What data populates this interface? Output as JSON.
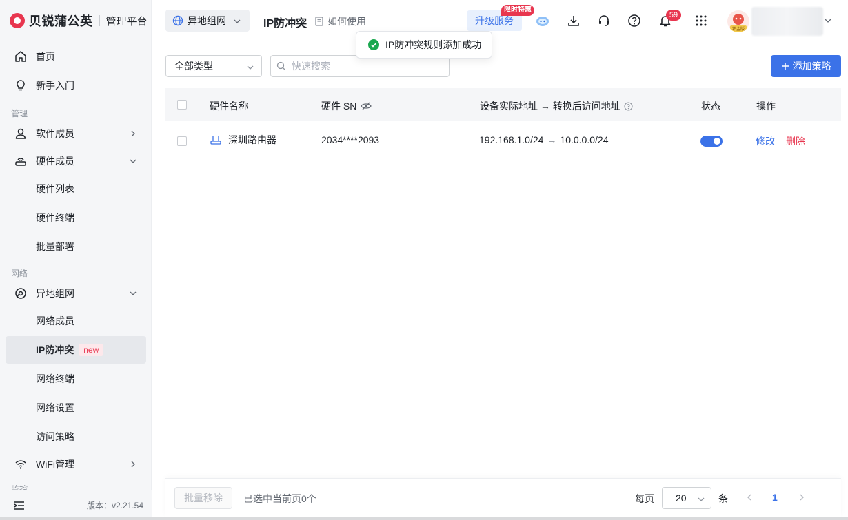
{
  "app": {
    "brand": "贝锐蒲公英",
    "platform": "管理平台",
    "version": "版本：v2.21.54"
  },
  "sidebar": {
    "items": [
      {
        "label": "首页"
      },
      {
        "label": "新手入门"
      },
      {
        "group": "管理"
      },
      {
        "label": "软件成员"
      },
      {
        "label": "硬件成员"
      },
      {
        "label": "硬件列表"
      },
      {
        "label": "硬件终端"
      },
      {
        "label": "批量部署"
      },
      {
        "group": "网络"
      },
      {
        "label": "异地组网"
      },
      {
        "label": "网络成员"
      },
      {
        "label": "IP防冲突",
        "badge": "new",
        "active": true
      },
      {
        "label": "网络终端"
      },
      {
        "label": "网络设置"
      },
      {
        "label": "访问策略"
      },
      {
        "label": "WiFi管理"
      },
      {
        "group": "监控"
      }
    ]
  },
  "topbar": {
    "network_selector": "异地组网",
    "page_title": "IP防冲突",
    "how_to": "如何使用",
    "upgrade_label": "升级服务",
    "promo_badge": "限时特惠",
    "notification_count": "59",
    "avatar_badge": "铂金版"
  },
  "toast": {
    "message": "IP防冲突规则添加成功",
    "type": "success"
  },
  "filters": {
    "type_select": "全部类型",
    "search_placeholder": "快速搜索",
    "add_button": "添加策略"
  },
  "table": {
    "columns": [
      "硬件名称",
      "硬件 SN",
      "设备实际地址 → 转换后访问地址",
      "状态",
      "操作"
    ],
    "rows": [
      {
        "name": "深圳路由器",
        "sn": "2034****2093",
        "real_addr": "192.168.1.0/24",
        "arrow": "→",
        "mapped_addr": "10.0.0.0/24",
        "enabled": true,
        "edit": "修改",
        "delete": "删除"
      }
    ]
  },
  "footer": {
    "bulk_remove": "批量移除",
    "selection_info": "已选中当前页0个",
    "per_page_label": "每页",
    "page_size": "20",
    "unit": "条",
    "current_page": "1"
  },
  "colors": {
    "primary": "#3b72e8",
    "danger": "#e8364f",
    "success": "#1aa84f"
  }
}
